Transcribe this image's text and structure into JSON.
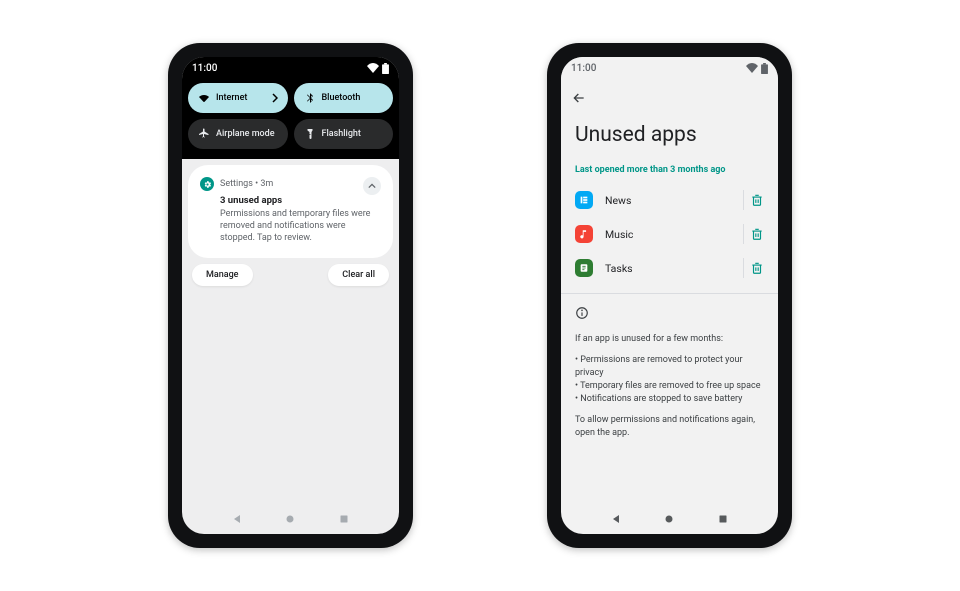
{
  "status_time": "11:00",
  "left": {
    "tiles": [
      {
        "id": "internet",
        "label": "Internet",
        "state": "on"
      },
      {
        "id": "bluetooth",
        "label": "Bluetooth",
        "state": "on"
      },
      {
        "id": "airplane",
        "label": "Airplane mode",
        "state": "off"
      },
      {
        "id": "flash",
        "label": "Flashlight",
        "state": "off"
      }
    ],
    "notification": {
      "app_name": "Settings",
      "time": "3m",
      "meta": "Settings • 3m",
      "title": "3 unused apps",
      "body": "Permissions and temporary files were removed and notifications were stopped. Tap to review."
    },
    "actions": {
      "manage": "Manage",
      "clear_all": "Clear all"
    }
  },
  "right": {
    "page_title": "Unused apps",
    "section_header": "Last opened more than 3 months ago",
    "apps": [
      {
        "name": "News",
        "color": "blue"
      },
      {
        "name": "Music",
        "color": "red"
      },
      {
        "name": "Tasks",
        "color": "green"
      }
    ],
    "info": {
      "intro": "If an app is unused for a few months:",
      "points": [
        "Permissions are removed to protect your privacy",
        "Temporary files are removed to free up space",
        "Notifications are stopped to save battery"
      ],
      "outro": "To allow permissions and notifications again, open the app."
    }
  }
}
